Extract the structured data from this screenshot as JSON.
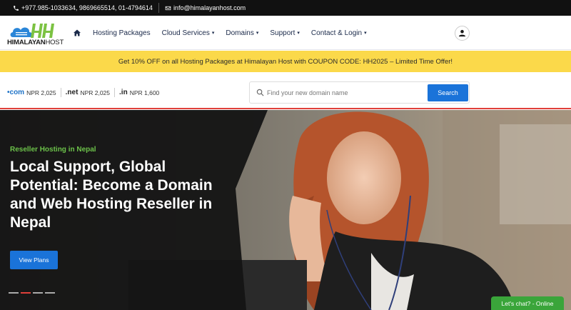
{
  "topbar": {
    "phone": "+977.985-1033634, 9869665514, 01-4794614",
    "email": "info@himalayanhost.com"
  },
  "brand": {
    "name_bold": "HIMALAYAN",
    "name_light": "HOST",
    "primary_color": "#1a73d9",
    "green": "#6cc24a"
  },
  "nav": {
    "home_icon": "home-icon",
    "items": [
      {
        "label": "Hosting Packages",
        "has_dropdown": false
      },
      {
        "label": "Cloud Services",
        "has_dropdown": true
      },
      {
        "label": "Domains",
        "has_dropdown": true
      },
      {
        "label": "Support",
        "has_dropdown": true
      },
      {
        "label": "Contact & Login",
        "has_dropdown": true
      }
    ],
    "caret": "▾"
  },
  "promo": {
    "text": "Get 10% OFF on all Hosting Packages at Himalayan Host with COUPON CODE: HH2025 – Limited Time Offer!",
    "bg_color": "#fbd94a"
  },
  "domains": {
    "tlds": [
      {
        "ext": "•com",
        "price": "NPR 2,025"
      },
      {
        "ext": ".net",
        "price": "NPR 2,025"
      },
      {
        "ext": ".in",
        "price": "NPR 1,600"
      }
    ],
    "search_placeholder": "Find your new domain name",
    "search_button": "Search"
  },
  "hero": {
    "subtitle": "Reseller Hosting in Nepal",
    "title": "Local Support, Global Potential: Become a Domain and Web Hosting Reseller in Nepal",
    "button": "View Plans",
    "slides": 4,
    "active_slide": 2
  },
  "chat": {
    "label": "Let's chat? - Online"
  }
}
